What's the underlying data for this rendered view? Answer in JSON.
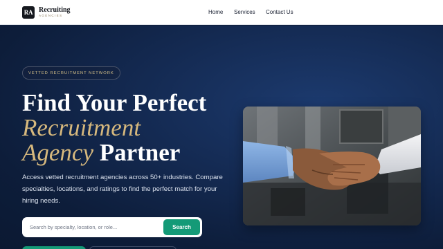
{
  "nav": {
    "logo_mark": "RA",
    "logo_name": "Recruiting",
    "logo_sub": "AGENCIES",
    "links": [
      "Home",
      "Services",
      "Contact Us"
    ]
  },
  "hero": {
    "badge": "VETTED RECRUITMENT NETWORK",
    "headline_line1": "Find Your Perfect",
    "headline_line2": "Recruitment",
    "headline_line3_gold": "Agency",
    "headline_line3_rest": " Partner",
    "subcopy": "Access vetted recruitment agencies across 50+ industries. Compare specialties, locations, and ratings to find the perfect match for your hiring needs.",
    "search": {
      "placeholder": "Search by specialty, location, or role...",
      "button": "Search"
    }
  },
  "colors": {
    "accent_gold": "#d6b87d",
    "accent_green": "#149a77",
    "hero_bg": "#142a52"
  },
  "image": {
    "subject": "handshake-photo"
  }
}
